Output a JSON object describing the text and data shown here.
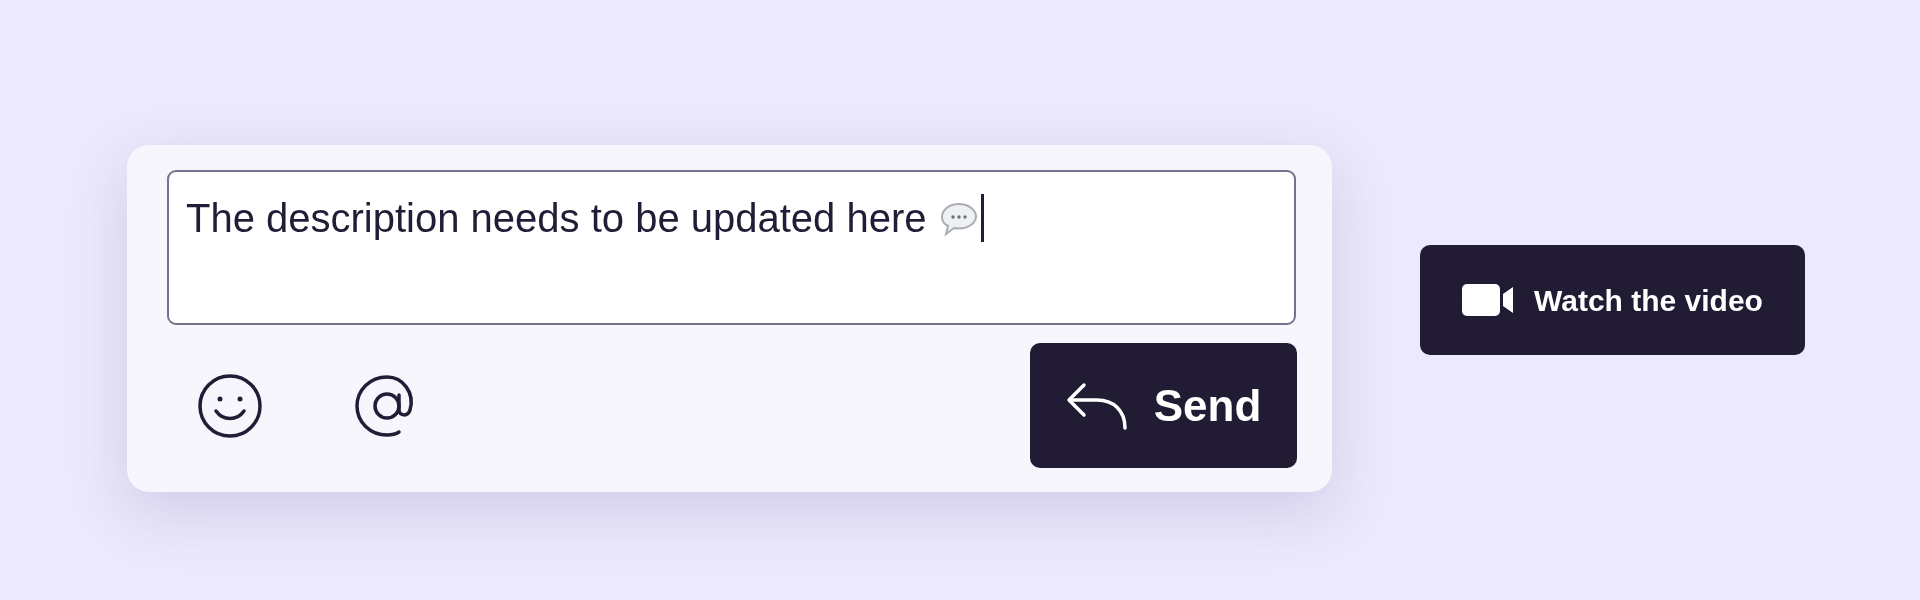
{
  "comment_box": {
    "value": "The description needs to be updated here",
    "send_button": "Send"
  },
  "video_button": "Watch the video"
}
